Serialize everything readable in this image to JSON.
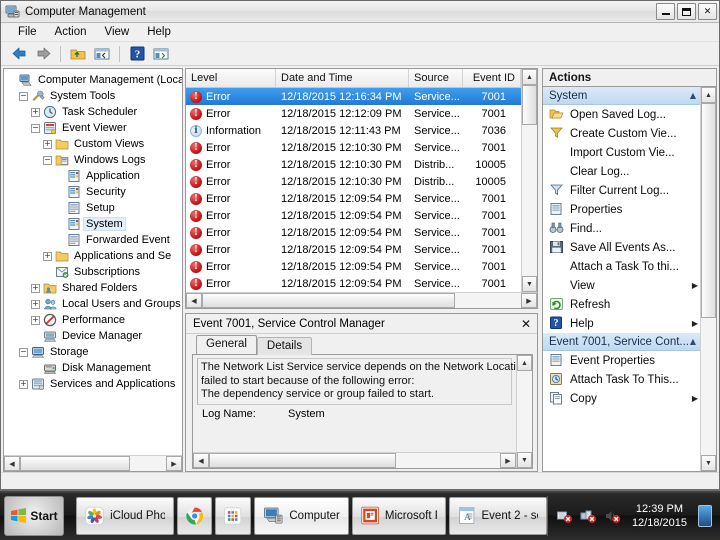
{
  "window": {
    "title": "Computer Management",
    "icon": "computer-management-icon",
    "buttons": {
      "minimize": "minimize",
      "maximize": "maximize",
      "close": "✕"
    }
  },
  "menu": {
    "items": [
      "File",
      "Action",
      "View",
      "Help"
    ]
  },
  "toolbar": {
    "items": [
      {
        "name": "back-icon",
        "glyph": "⬅"
      },
      {
        "name": "forward-icon",
        "glyph": "➡"
      },
      {
        "name": "up-folder-icon",
        "glyph": "folder"
      },
      {
        "name": "show-hide-tree-icon",
        "glyph": "pane"
      },
      {
        "name": "help-icon",
        "glyph": "?"
      },
      {
        "name": "properties-icon",
        "glyph": "pane2"
      }
    ]
  },
  "tree": {
    "items": [
      {
        "label": "Computer Management (Local",
        "indent": 0,
        "expander": "none",
        "icon": "computer-icon",
        "selected": false
      },
      {
        "label": "System Tools",
        "indent": 1,
        "expander": "minus",
        "icon": "tools-icon",
        "selected": false
      },
      {
        "label": "Task Scheduler",
        "indent": 2,
        "expander": "plus",
        "icon": "clock-icon",
        "selected": false
      },
      {
        "label": "Event Viewer",
        "indent": 2,
        "expander": "minus",
        "icon": "event-viewer-icon",
        "selected": false
      },
      {
        "label": "Custom Views",
        "indent": 3,
        "expander": "plus",
        "icon": "folder-icon",
        "selected": false
      },
      {
        "label": "Windows Logs",
        "indent": 3,
        "expander": "minus",
        "icon": "logs-folder-icon",
        "selected": false
      },
      {
        "label": "Application",
        "indent": 4,
        "expander": "none",
        "icon": "log-icon",
        "selected": false
      },
      {
        "label": "Security",
        "indent": 4,
        "expander": "none",
        "icon": "log-icon",
        "selected": false
      },
      {
        "label": "Setup",
        "indent": 4,
        "expander": "none",
        "icon": "log-plain-icon",
        "selected": false
      },
      {
        "label": "System",
        "indent": 4,
        "expander": "none",
        "icon": "log-icon",
        "selected": true
      },
      {
        "label": "Forwarded Event",
        "indent": 4,
        "expander": "none",
        "icon": "log-plain-icon",
        "selected": false
      },
      {
        "label": "Applications and Se",
        "indent": 3,
        "expander": "plus",
        "icon": "folder-icon",
        "selected": false
      },
      {
        "label": "Subscriptions",
        "indent": 3,
        "expander": "none",
        "icon": "subscriptions-icon",
        "selected": false
      },
      {
        "label": "Shared Folders",
        "indent": 2,
        "expander": "plus",
        "icon": "shared-folders-icon",
        "selected": false
      },
      {
        "label": "Local Users and Groups",
        "indent": 2,
        "expander": "plus",
        "icon": "users-icon",
        "selected": false
      },
      {
        "label": "Performance",
        "indent": 2,
        "expander": "plus",
        "icon": "performance-icon",
        "selected": false
      },
      {
        "label": "Device Manager",
        "indent": 2,
        "expander": "none",
        "icon": "device-manager-icon",
        "selected": false
      },
      {
        "label": "Storage",
        "indent": 1,
        "expander": "minus",
        "icon": "storage-icon",
        "selected": false
      },
      {
        "label": "Disk Management",
        "indent": 2,
        "expander": "none",
        "icon": "disk-icon",
        "selected": false
      },
      {
        "label": "Services and Applications",
        "indent": 1,
        "expander": "plus",
        "icon": "services-icon",
        "selected": false
      }
    ]
  },
  "event_list": {
    "columns": [
      "Level",
      "Date and Time",
      "Source",
      "Event ID"
    ],
    "rows": [
      {
        "level": "Error",
        "severity": "error",
        "date": "12/18/2015 12:16:34 PM",
        "source": "Service...",
        "id": "7001",
        "selected": true
      },
      {
        "level": "Error",
        "severity": "error",
        "date": "12/18/2015 12:12:09 PM",
        "source": "Service...",
        "id": "7001",
        "selected": false
      },
      {
        "level": "Information",
        "severity": "information",
        "date": "12/18/2015 12:11:43 PM",
        "source": "Service...",
        "id": "7036",
        "selected": false
      },
      {
        "level": "Error",
        "severity": "error",
        "date": "12/18/2015 12:10:30 PM",
        "source": "Service...",
        "id": "7001",
        "selected": false
      },
      {
        "level": "Error",
        "severity": "error",
        "date": "12/18/2015 12:10:30 PM",
        "source": "Distrib...",
        "id": "10005",
        "selected": false
      },
      {
        "level": "Error",
        "severity": "error",
        "date": "12/18/2015 12:10:30 PM",
        "source": "Distrib...",
        "id": "10005",
        "selected": false
      },
      {
        "level": "Error",
        "severity": "error",
        "date": "12/18/2015 12:09:54 PM",
        "source": "Service...",
        "id": "7001",
        "selected": false
      },
      {
        "level": "Error",
        "severity": "error",
        "date": "12/18/2015 12:09:54 PM",
        "source": "Service...",
        "id": "7001",
        "selected": false
      },
      {
        "level": "Error",
        "severity": "error",
        "date": "12/18/2015 12:09:54 PM",
        "source": "Service...",
        "id": "7001",
        "selected": false
      },
      {
        "level": "Error",
        "severity": "error",
        "date": "12/18/2015 12:09:54 PM",
        "source": "Service...",
        "id": "7001",
        "selected": false
      },
      {
        "level": "Error",
        "severity": "error",
        "date": "12/18/2015 12:09:54 PM",
        "source": "Service...",
        "id": "7001",
        "selected": false
      },
      {
        "level": "Error",
        "severity": "error",
        "date": "12/18/2015 12:09:54 PM",
        "source": "Service...",
        "id": "7001",
        "selected": false
      }
    ]
  },
  "detail": {
    "title": "Event 7001, Service Control Manager",
    "close_glyph": "✕",
    "tabs": [
      {
        "label": "General",
        "active": true
      },
      {
        "label": "Details",
        "active": false
      }
    ],
    "description_lines": [
      "The Network List Service service depends on the Network Locati",
      "failed to start because of the following error:",
      "The dependency service or group failed to start."
    ],
    "fields": [
      {
        "key": "Log Name:",
        "value": "System"
      }
    ]
  },
  "actions": {
    "header": "Actions",
    "groups": [
      {
        "title": "System",
        "collapse_glyph": "▲",
        "items": [
          {
            "label": "Open Saved Log...",
            "icon": "open-folder-icon",
            "submenu": false
          },
          {
            "label": "Create Custom Vie...",
            "icon": "filter-yellow-icon",
            "submenu": false
          },
          {
            "label": "Import Custom Vie...",
            "icon": "none",
            "submenu": false
          },
          {
            "label": "Clear Log...",
            "icon": "none",
            "submenu": false
          },
          {
            "label": "Filter Current Log...",
            "icon": "filter-icon",
            "submenu": false
          },
          {
            "label": "Properties",
            "icon": "properties-icon",
            "submenu": false
          },
          {
            "label": "Find...",
            "icon": "binoculars-icon",
            "submenu": false
          },
          {
            "label": "Save All Events As...",
            "icon": "save-icon",
            "submenu": false
          },
          {
            "label": "Attach a Task To thi...",
            "icon": "none",
            "submenu": false
          },
          {
            "label": "View",
            "icon": "none",
            "submenu": true
          },
          {
            "label": "Refresh",
            "icon": "refresh-icon",
            "submenu": false
          },
          {
            "label": "Help",
            "icon": "help-icon",
            "submenu": true
          }
        ]
      },
      {
        "title": "Event 7001, Service Cont...",
        "collapse_glyph": "▲",
        "items": [
          {
            "label": "Event Properties",
            "icon": "properties-icon",
            "submenu": false
          },
          {
            "label": "Attach Task To This...",
            "icon": "attach-task-icon",
            "submenu": false
          },
          {
            "label": "Copy",
            "icon": "copy-icon",
            "submenu": true
          }
        ]
      }
    ]
  },
  "taskbar": {
    "start": "Start",
    "tasks": [
      {
        "label": "iCloud Phot...",
        "icon": "icloud-photos-icon",
        "active": false
      },
      {
        "label": "",
        "icon": "chrome-icon",
        "active": false
      },
      {
        "label": "",
        "icon": "apps-grid-icon",
        "active": false
      },
      {
        "label": "Computer ...",
        "icon": "computer-management-icon",
        "active": true
      },
      {
        "label": "Microsoft P...",
        "icon": "powerpoint-icon",
        "active": false
      },
      {
        "label": "Event 2 - se...",
        "icon": "document-icon",
        "active": false
      }
    ],
    "tray": [
      "network-error-icon",
      "network-disconnected-icon",
      "volume-muted-icon"
    ],
    "clock": {
      "time": "12:39 PM",
      "date": "12/18/2015"
    }
  }
}
